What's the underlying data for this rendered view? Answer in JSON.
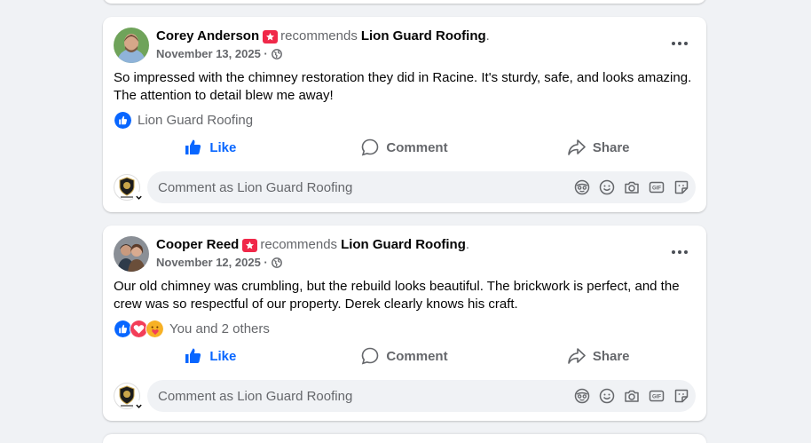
{
  "posts": [
    {
      "author": "Corey Anderson",
      "recommends_text": "recommends",
      "page_name": "Lion Guard Roofing",
      "date": "November 13, 2025 ·",
      "body": "So impressed with the chimney restoration they did in Racine. It's sturdy, safe, and looks amazing. The attention to detail blew me away!",
      "reactions_text": "Lion Guard Roofing",
      "reaction_types": [
        "like"
      ],
      "like_label": "Like",
      "comment_label": "Comment",
      "share_label": "Share",
      "comment_placeholder": "Comment as Lion Guard Roofing"
    },
    {
      "author": "Cooper Reed",
      "recommends_text": "recommends",
      "page_name": "Lion Guard Roofing",
      "date": "November 12, 2025 ·",
      "body": "Our old chimney was crumbling, but the rebuild looks beautiful. The brickwork is perfect, and the crew was so respectful of our property. Derek clearly knows his craft.",
      "reactions_text": "You and 2 others",
      "reaction_types": [
        "like",
        "love",
        "care"
      ],
      "like_label": "Like",
      "comment_label": "Comment",
      "share_label": "Share",
      "comment_placeholder": "Comment as Lion Guard Roofing"
    }
  ],
  "colors": {
    "brand_blue": "#0866ff",
    "secondary_text": "#65676b",
    "recommend_badge": "#f02849",
    "love": "#f33e58",
    "care": "#f7b125"
  },
  "icons": {
    "recommend": "recommend-badge-icon",
    "globe": "globe-icon",
    "more": "more-options-icon",
    "like": "thumbs-up-icon",
    "comment": "speech-bubble-icon",
    "share": "share-arrow-icon",
    "comment_tools": [
      "avatar-sticker-icon",
      "emoji-icon",
      "camera-icon",
      "gif-icon",
      "sticker-icon"
    ]
  }
}
